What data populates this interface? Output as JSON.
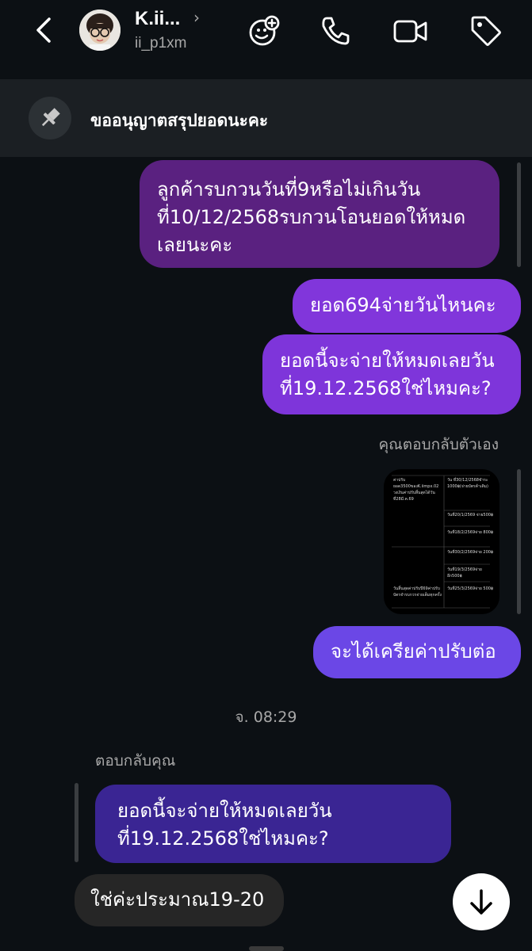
{
  "header": {
    "title": "K.ii...",
    "chevron": "›",
    "username": "ii_p1xm"
  },
  "pinned": {
    "text": "ขออนุญาตสรุปยอดนะคะ"
  },
  "messages": {
    "m1": "ลูกค้ารบกวนวันที่9หรือไม่เกินวันที่10/12/2568รบกวนโอนยอดให้หมดเลยนะคะ",
    "m2": "ยอด694จ่ายวันไหนคะ",
    "m3": "ยอดนี้จะจ่ายให้หมดเลยวันที่19.12.2568ใช่ไหมคะ?",
    "reply_self_label": "คุณตอบกลับตัวเอง",
    "m4": "จะได้เครียค่าปรับต่อ",
    "timestamp": "จ. 08:29",
    "reply_you_label": "ตอบกลับคุณ",
    "quoted": "ยอดนี้จะจ่ายให้หมดเลยวันที่19.12.2568ใช่ไหมคะ?",
    "m5": "ใช่ค่ะประมาณ19-20"
  },
  "thumbnail_text": {
    "c1": "ค่าปรับ ยอด3500ของK.iimpx.02 วงเงินค่าปรับสิ้นสุดได้วันที่28มี.ค.69",
    "c2": "วัน ที่30/12/2568ชำระ 1000฿(จ่ายบัตรค้าเดิม)",
    "c3": "วันที่20/1/2569 จ่าย500฿",
    "c4": "วันที่18/2/2569จ่าย 800฿",
    "c5": "วันที่30/2/2569จ่าย 200฿",
    "c6": "วันที่19/3/2569จ่าย อีก500฿",
    "c7": "วันสิ้นสุดค่าปรับปี69ค่าปรับบัตรจำรบกวรจ่ายเต็มทุกครั้ง",
    "c8": "วันที่25/3/2569จ่าย 500฿"
  },
  "icons": {
    "back": "chevron-left-icon",
    "add_friends": "add-friends-icon",
    "call": "phone-icon",
    "video": "video-camera-icon",
    "tag": "tag-icon",
    "pin": "pin-icon",
    "scroll_down": "arrow-down-icon"
  },
  "colors": {
    "background": "#0c1014",
    "pinned_bar": "#1b1f23",
    "bubble_dark_purple": "#5a2180",
    "bubble_purple": "#8136db",
    "bubble_violet": "#6b47e6",
    "quoted_bubble": "#3a2593",
    "received_bubble": "#262626"
  }
}
